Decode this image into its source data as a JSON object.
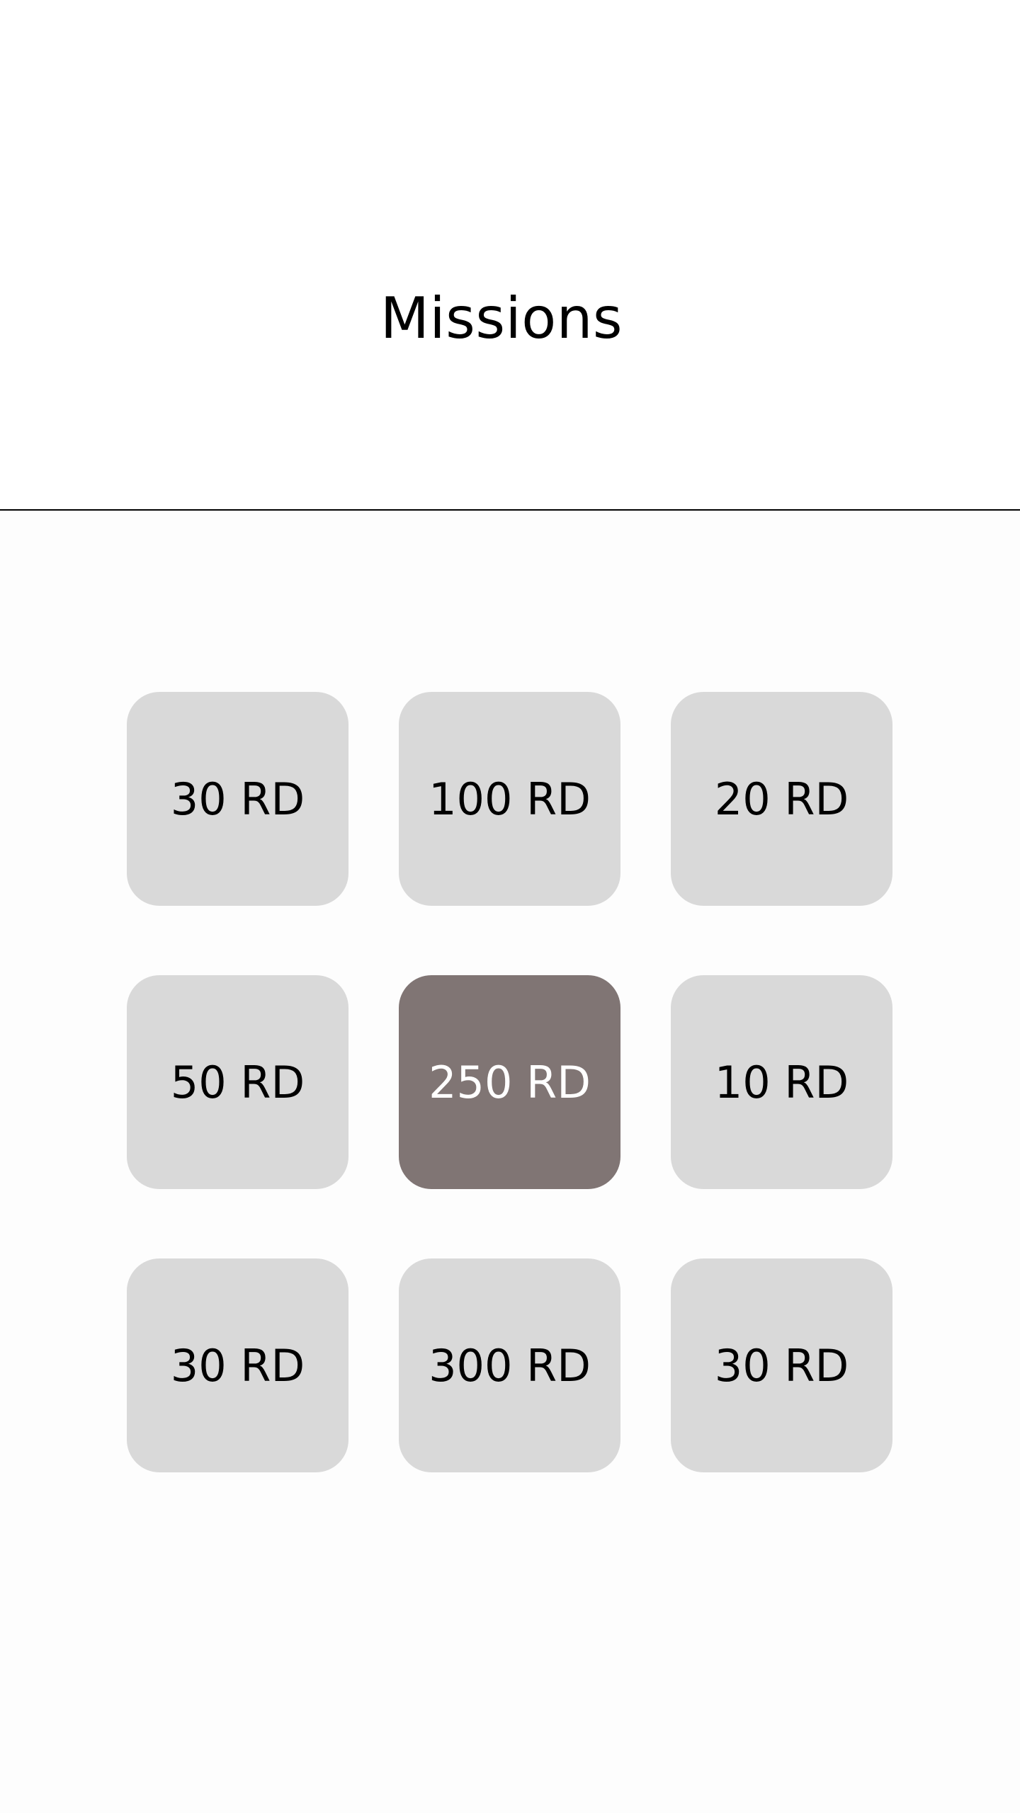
{
  "header": {
    "title": "Missions"
  },
  "missions": [
    {
      "label": "30 RD",
      "selected": false
    },
    {
      "label": "100 RD",
      "selected": false
    },
    {
      "label": "20 RD",
      "selected": false
    },
    {
      "label": "50 RD",
      "selected": false
    },
    {
      "label": "250 RD",
      "selected": true
    },
    {
      "label": "10 RD",
      "selected": false
    },
    {
      "label": "30 RD",
      "selected": false
    },
    {
      "label": "300 RD",
      "selected": false
    },
    {
      "label": "30 RD",
      "selected": false
    }
  ],
  "colors": {
    "tile": "#d9d9d9",
    "tile_selected": "#807574",
    "text": "#000000",
    "text_selected": "#ffffff"
  }
}
